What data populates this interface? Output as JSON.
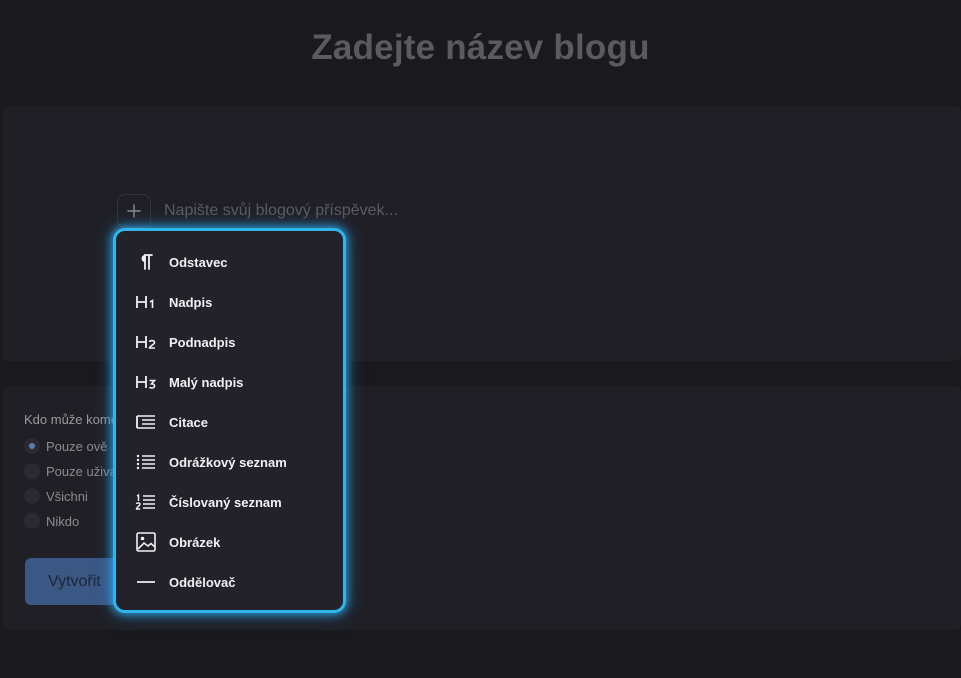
{
  "blog": {
    "title_placeholder": "Zadejte název blogu",
    "body_placeholder": "Napište svůj blogový příspěvek..."
  },
  "comments": {
    "label": "Kdo může kome",
    "options": [
      {
        "label": "Pouze ově",
        "selected": true
      },
      {
        "label": "Pouze uživa",
        "selected": false
      },
      {
        "label": "Všichni",
        "selected": false
      },
      {
        "label": "Nikdo",
        "selected": false
      }
    ]
  },
  "actions": {
    "create_label": "Vytvořit"
  },
  "block_menu": {
    "accent_color": "#2fb5ec",
    "items": [
      {
        "label": "Odstavec",
        "icon": "paragraph-icon"
      },
      {
        "label": "Nadpis",
        "icon": "heading-1-icon"
      },
      {
        "label": "Podnadpis",
        "icon": "heading-2-icon"
      },
      {
        "label": "Malý nadpis",
        "icon": "heading-3-icon"
      },
      {
        "label": "Citace",
        "icon": "quote-icon"
      },
      {
        "label": "Odrážkový seznam",
        "icon": "bullet-list-icon"
      },
      {
        "label": "Číslovaný seznam",
        "icon": "numbered-list-icon"
      },
      {
        "label": "Obrázek",
        "icon": "image-icon"
      },
      {
        "label": "Oddělovač",
        "icon": "divider-icon"
      }
    ]
  }
}
